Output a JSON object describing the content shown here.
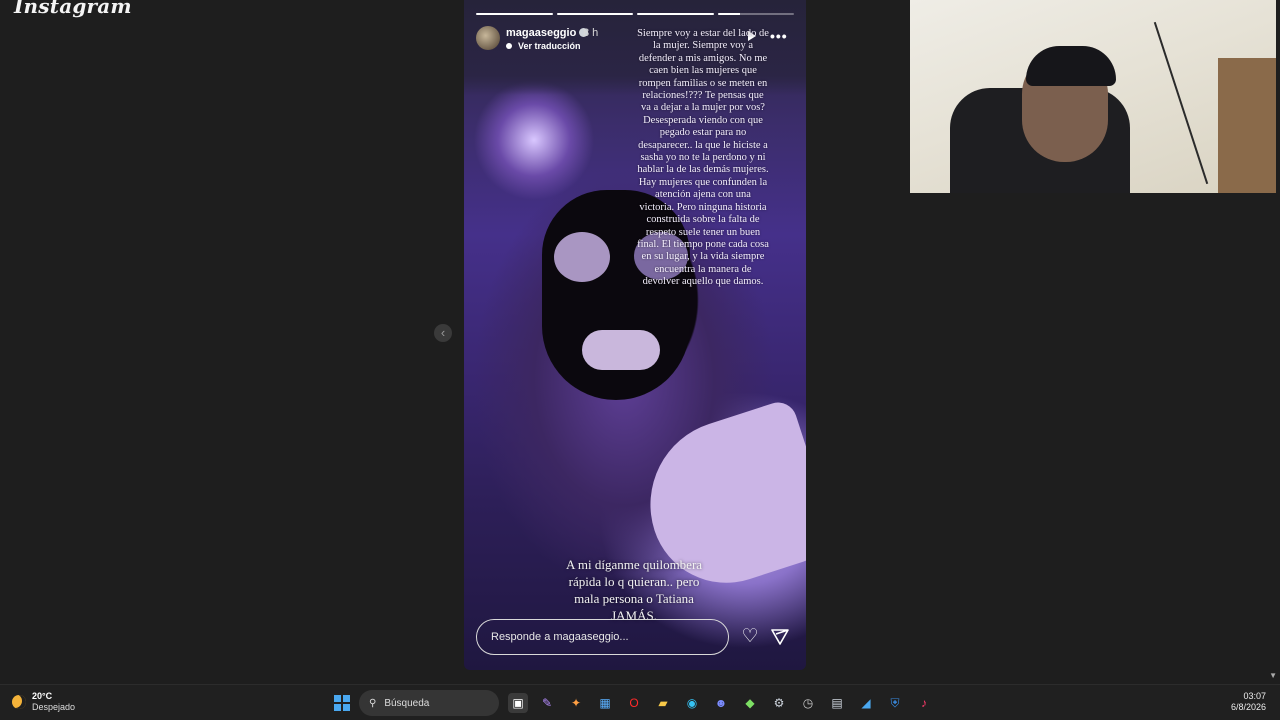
{
  "app": {
    "logo": "Instagram"
  },
  "story": {
    "username": "magaaseggio",
    "time": "8 h",
    "translate_label": "Ver traducción",
    "more_label": "•••",
    "progress": [
      1,
      1,
      1,
      0.3
    ],
    "overlay_text": "Siempre voy a estar del lado de la mujer. Siempre voy a defender a mis amigos. No me caen bien las mujeres que rompen familias o se meten en relaciones!??? Te pensas que va a dejar a la mujer por vos? Desesperada viendo con que pegado estar para no desaparecer.. la que le hiciste a sasha yo no te la perdono y ni hablar la de las demás mujeres.  Hay mujeres que confunden la atención ajena con una victoria. Pero ninguna historia construida sobre la falta de respeto suele tener un buen final. El tiempo pone cada cosa en su lugar, y la vida siempre encuentra la manera de devolver aquello que damos.",
    "caption": "A mi díganme quilombera rápida lo q quieran.. pero mala persona o Tatiana JAMÁS.",
    "reply_placeholder": "Responde a magaaseggio..."
  },
  "taskbar": {
    "weather_temp": "20°C",
    "weather_desc": "Despejado",
    "search_label": "Búsqueda",
    "clock_time": "03:07",
    "clock_date": "6/8/2026",
    "colors": {
      "accent": "#4aa8f0",
      "background": "#202020"
    }
  }
}
